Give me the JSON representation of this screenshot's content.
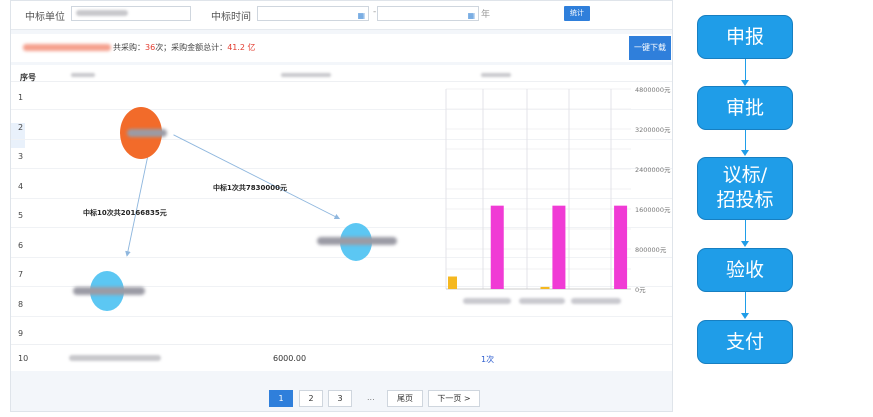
{
  "filters": {
    "unit_label": "中标单位",
    "time_label": "中标时间",
    "date_separator": "-",
    "date_unit": "年",
    "stat_button": "统计"
  },
  "summary": {
    "text_prefix": "共采购：",
    "count": "36",
    "text_mid": "次；采购金额总计：",
    "total": "41.2 亿",
    "export_button": "一键下载"
  },
  "table": {
    "header_index": "序号",
    "rows": [
      "1",
      "2",
      "3",
      "4",
      "5",
      "6",
      "7",
      "8",
      "9"
    ],
    "last_row": {
      "index": "10",
      "amount": "6000.00",
      "times": "1次"
    }
  },
  "graph": {
    "edge1_label": "中标10次共20166835元",
    "edge2_label": "中标1次共7830000元"
  },
  "chart_data": {
    "type": "bar",
    "y_tick_labels": [
      "4800000元",
      "3200000元",
      "2400000元",
      "1600000元",
      "800000元",
      "0元"
    ],
    "ylim": [
      0,
      4800000
    ],
    "categories": [
      "",
      "",
      "",
      "",
      "",
      ""
    ],
    "series": [
      {
        "color": "#f5b820",
        "values": [
          300000,
          0,
          0,
          50000,
          0,
          0
        ]
      },
      {
        "color": "#f03bd5",
        "values": [
          0,
          2000000,
          0,
          2000000,
          0,
          2000000
        ]
      }
    ]
  },
  "pagination": {
    "pages": [
      "1",
      "2",
      "3"
    ],
    "ellipsis": "...",
    "last": "尾页",
    "next": "下一页 >"
  },
  "flow": {
    "steps": [
      "申报",
      "审批",
      "议标/\n招投标",
      "验收",
      "支付"
    ]
  }
}
